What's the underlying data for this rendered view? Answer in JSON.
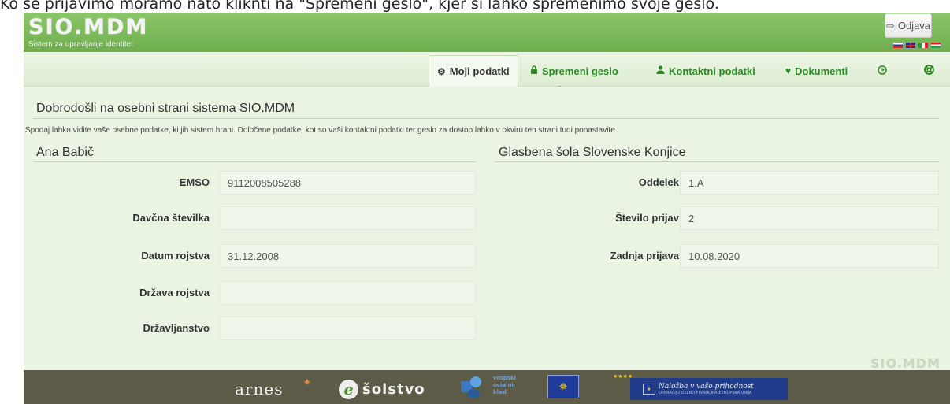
{
  "caption": "Ko se prijavimo moramo nato kliknti na \"Spremeni geslo\", kjer si lahko spremenimo svoje geslo.",
  "header": {
    "logo": "SIO.MDM",
    "subtitle": "Sistem za upravljanje identitet",
    "logout_label": "Odjava",
    "logout_icon": "sign-out-icon",
    "flags": [
      "slovenian-flag",
      "uk-flag",
      "italian-flag",
      "hungarian-flag"
    ]
  },
  "nav": {
    "tabs": [
      {
        "label": "Moji podatki",
        "icon": "dashboard-icon",
        "active": true
      },
      {
        "label": "Spremeni geslo",
        "icon": "lock-icon"
      },
      {
        "label": "Kontaktni podatki",
        "icon": "user-icon"
      },
      {
        "label": "Dokumenti",
        "icon": "heart-icon"
      },
      {
        "label": "",
        "icon": "clock-icon"
      },
      {
        "label": "",
        "icon": "lifebuoy-icon"
      }
    ]
  },
  "main": {
    "welcome": "Dobrodošli na osebni strani sistema SIO.MDM",
    "intro": "Spodaj lahko vidite vaše osebne podatke, ki jih sistem hrani. Določene podatke, kot so vaši kontaktni podatki ter geslo za dostop lahko v okviru teh strani tudi ponastavite.",
    "person": {
      "name": "Ana Babič",
      "fields": [
        {
          "label": "EMSO",
          "value": "9112008505288"
        },
        {
          "label": "Davčna številka",
          "value": ""
        },
        {
          "label": "Datum rojstva",
          "value": "31.12.2008"
        },
        {
          "label": "Država rojstva",
          "value": ""
        },
        {
          "label": "Državljanstvo",
          "value": ""
        }
      ]
    },
    "school": {
      "name": "Glasbena šola Slovenske Konjice",
      "fields": [
        {
          "label": "Oddelek",
          "value": "1.A"
        },
        {
          "label": "Število prijav",
          "value": "2"
        },
        {
          "label": "Zadnja prijava",
          "value": "10.08.2020"
        }
      ]
    },
    "watermark": "SIO.MDM"
  },
  "footer": {
    "arnes": "arnes",
    "solstvo": "šolstvo",
    "esf_text": [
      "vropski",
      "ocialni",
      "klad"
    ],
    "eu_banner": "Naložba v vašo prihodnost",
    "eu_banner_small": "OPERACIJO DELNO FINANCIRA EVROPSKA UNIJA"
  },
  "colors": {
    "header_green": "#77b456",
    "link_green": "#2e8a25",
    "content_bg": "#e9f4e2",
    "footer_bg": "#5b5b48",
    "arrow_red": "#e02020"
  }
}
